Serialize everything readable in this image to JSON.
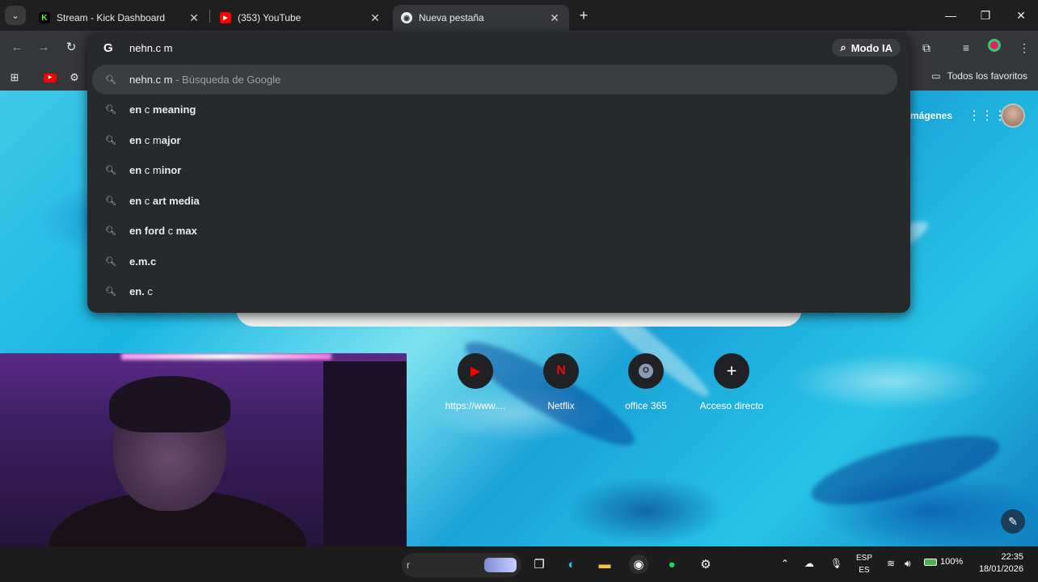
{
  "tabs": [
    {
      "title": "Stream - Kick Dashboard",
      "favicon": "kick-icon",
      "color": "#53fc18"
    },
    {
      "title": "(353) YouTube",
      "favicon": "youtube-icon",
      "color": "#ff0000"
    },
    {
      "title": "Nueva pestaña",
      "favicon": "chrome-icon",
      "active": true
    }
  ],
  "omnibox": {
    "input_text": "nehn.c m",
    "mode_button": "Modo IA",
    "suggestions": [
      {
        "bold": "nehn.c m",
        "rest": "",
        "desc": "- Búsqueda de Google"
      },
      {
        "bold": "en",
        "rest": " c ",
        "bold2": "meaning"
      },
      {
        "bold": "en",
        "rest": " c m",
        "bold2": "ajor"
      },
      {
        "bold": "en",
        "rest": " c m",
        "bold2": "inor"
      },
      {
        "bold": "en",
        "rest": " c ",
        "bold2": "art media"
      },
      {
        "bold": "en ford",
        "rest": " c ",
        "bold2": "max"
      },
      {
        "bold": "e.m.c",
        "rest": "",
        "bold2": ""
      },
      {
        "bold": "en.",
        "rest": " c",
        "bold2": ""
      }
    ]
  },
  "bookmarks": {
    "all_favorites": "Todos los favoritos"
  },
  "ntp": {
    "images_link": "mágenes",
    "shortcuts": [
      {
        "label": "https://www....",
        "icon": "youtube-icon"
      },
      {
        "label": "Netflix",
        "icon": "netflix-icon"
      },
      {
        "label": "office 365",
        "icon": "office-icon"
      },
      {
        "label": "Acceso directo",
        "icon": "plus-icon"
      }
    ]
  },
  "taskbar": {
    "search_text": "r",
    "lang_top": "ESP",
    "lang_bottom": "ES",
    "battery": "100%",
    "time": "22:35",
    "date": "18/01/2026"
  },
  "colors": {
    "accent": "#8ab4f8",
    "omnibox_bg": "#28292c",
    "toolbar_bg": "#35363a"
  }
}
